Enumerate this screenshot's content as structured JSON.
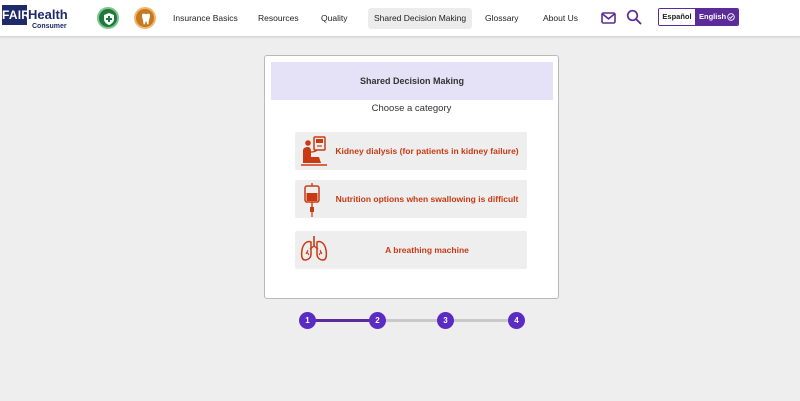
{
  "brand": {
    "logo_fair": "FAIR",
    "logo_health": "Health",
    "logo_consumer": "Consumer"
  },
  "header": {
    "medical_icon": "shield-cross-icon",
    "dental_icon": "tooth-icon",
    "nav": [
      {
        "label": "Insurance Basics"
      },
      {
        "label": "Resources"
      },
      {
        "label": "Quality"
      },
      {
        "label": "Shared Decision Making"
      },
      {
        "label": "Glossary"
      },
      {
        "label": "About Us"
      }
    ],
    "mail_icon": "mail-icon",
    "search_icon": "search-icon",
    "lang": {
      "spanish": "Español",
      "english": "English"
    }
  },
  "card": {
    "title": "Shared Decision Making",
    "subtitle": "Choose a category",
    "options": [
      {
        "label": "Kidney dialysis (for patients in kidney failure)",
        "icon": "dialysis-icon"
      },
      {
        "label": "Nutrition options when swallowing is difficult",
        "icon": "iv-bag-icon"
      },
      {
        "label": "A breathing machine",
        "icon": "lungs-icon"
      }
    ]
  },
  "stepper": {
    "steps": [
      "1",
      "2",
      "3",
      "4"
    ],
    "current_step": 2
  },
  "colors": {
    "navy": "#1f2a6b",
    "purple": "#5b2c98",
    "step": "#5b2cc4",
    "orange": "#c93a12",
    "header_band": "#e5e1f6"
  }
}
